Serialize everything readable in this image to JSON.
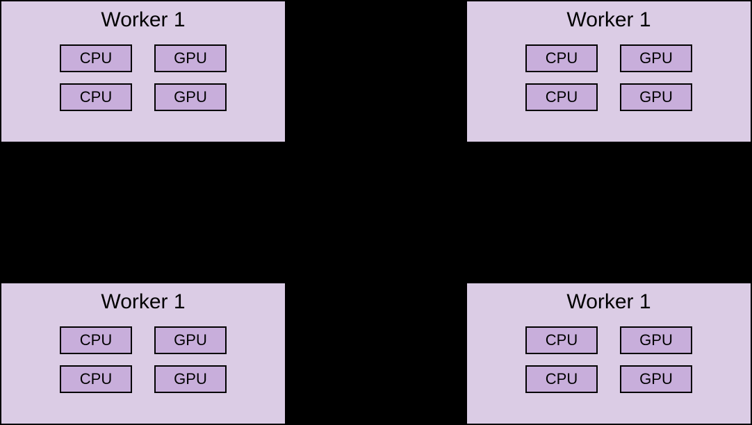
{
  "workers": [
    {
      "title": "Worker 1",
      "units": [
        {
          "label": "CPU"
        },
        {
          "label": "GPU"
        },
        {
          "label": "CPU"
        },
        {
          "label": "GPU"
        }
      ]
    },
    {
      "title": "Worker 1",
      "units": [
        {
          "label": "CPU"
        },
        {
          "label": "GPU"
        },
        {
          "label": "CPU"
        },
        {
          "label": "GPU"
        }
      ]
    },
    {
      "title": "Worker 1",
      "units": [
        {
          "label": "CPU"
        },
        {
          "label": "GPU"
        },
        {
          "label": "CPU"
        },
        {
          "label": "GPU"
        }
      ]
    },
    {
      "title": "Worker 1",
      "units": [
        {
          "label": "CPU"
        },
        {
          "label": "GPU"
        },
        {
          "label": "CPU"
        },
        {
          "label": "GPU"
        }
      ]
    }
  ]
}
